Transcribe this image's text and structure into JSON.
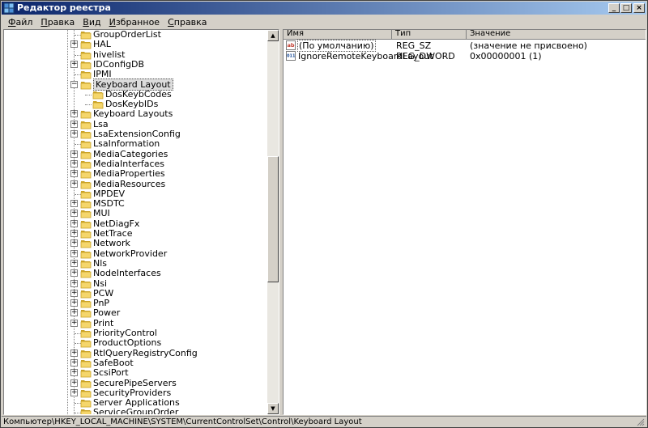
{
  "window": {
    "title": "Редактор реестра",
    "controls": {
      "minimize": "_",
      "maximize": "□",
      "close": "×"
    }
  },
  "menu": [
    {
      "hotkey": "Ф",
      "rest": "айл"
    },
    {
      "hotkey": "П",
      "rest": "равка"
    },
    {
      "hotkey": "В",
      "rest": "ид"
    },
    {
      "hotkey": "И",
      "rest": "збранное"
    },
    {
      "hotkey": "С",
      "rest": "правка"
    }
  ],
  "tree": {
    "items": [
      {
        "label": "GroupOrderList",
        "level": 0,
        "expander": ""
      },
      {
        "label": "HAL",
        "level": 0,
        "expander": "+"
      },
      {
        "label": "hivelist",
        "level": 0,
        "expander": ""
      },
      {
        "label": "IDConfigDB",
        "level": 0,
        "expander": "+"
      },
      {
        "label": "IPMI",
        "level": 0,
        "expander": ""
      },
      {
        "label": "Keyboard Layout",
        "level": 0,
        "expander": "-",
        "selected": true,
        "open": true
      },
      {
        "label": "DosKeybCodes",
        "level": 1,
        "expander": ""
      },
      {
        "label": "DosKeybIDs",
        "level": 1,
        "expander": ""
      },
      {
        "label": "Keyboard Layouts",
        "level": 0,
        "expander": "+"
      },
      {
        "label": "Lsa",
        "level": 0,
        "expander": "+"
      },
      {
        "label": "LsaExtensionConfig",
        "level": 0,
        "expander": "+"
      },
      {
        "label": "LsaInformation",
        "level": 0,
        "expander": ""
      },
      {
        "label": "MediaCategories",
        "level": 0,
        "expander": "+"
      },
      {
        "label": "MediaInterfaces",
        "level": 0,
        "expander": "+"
      },
      {
        "label": "MediaProperties",
        "level": 0,
        "expander": "+"
      },
      {
        "label": "MediaResources",
        "level": 0,
        "expander": "+"
      },
      {
        "label": "MPDEV",
        "level": 0,
        "expander": ""
      },
      {
        "label": "MSDTC",
        "level": 0,
        "expander": "+"
      },
      {
        "label": "MUI",
        "level": 0,
        "expander": "+"
      },
      {
        "label": "NetDiagFx",
        "level": 0,
        "expander": "+"
      },
      {
        "label": "NetTrace",
        "level": 0,
        "expander": "+"
      },
      {
        "label": "Network",
        "level": 0,
        "expander": "+"
      },
      {
        "label": "NetworkProvider",
        "level": 0,
        "expander": "+"
      },
      {
        "label": "Nls",
        "level": 0,
        "expander": "+"
      },
      {
        "label": "NodeInterfaces",
        "level": 0,
        "expander": "+"
      },
      {
        "label": "Nsi",
        "level": 0,
        "expander": "+"
      },
      {
        "label": "PCW",
        "level": 0,
        "expander": "+"
      },
      {
        "label": "PnP",
        "level": 0,
        "expander": "+"
      },
      {
        "label": "Power",
        "level": 0,
        "expander": "+"
      },
      {
        "label": "Print",
        "level": 0,
        "expander": "+"
      },
      {
        "label": "PriorityControl",
        "level": 0,
        "expander": ""
      },
      {
        "label": "ProductOptions",
        "level": 0,
        "expander": ""
      },
      {
        "label": "RtlQueryRegistryConfig",
        "level": 0,
        "expander": "+"
      },
      {
        "label": "SafeBoot",
        "level": 0,
        "expander": "+"
      },
      {
        "label": "ScsiPort",
        "level": 0,
        "expander": "+"
      },
      {
        "label": "SecurePipeServers",
        "level": 0,
        "expander": "+"
      },
      {
        "label": "SecurityProviders",
        "level": 0,
        "expander": "+"
      },
      {
        "label": "Server Applications",
        "level": 0,
        "expander": ""
      },
      {
        "label": "ServiceGroupOrder",
        "level": 0,
        "expander": ""
      }
    ]
  },
  "list": {
    "columns": {
      "name": "Имя",
      "type": "Тип",
      "value": "Значение"
    },
    "rows": [
      {
        "icon": "string-value-icon",
        "icon_text": "ab",
        "name": "(По умолчанию)",
        "type": "REG_SZ",
        "value": "(значение не присвоено)"
      },
      {
        "icon": "binary-value-icon",
        "icon_text": "011",
        "name": "IgnoreRemoteKeyboardLayout",
        "type": "REG_DWORD",
        "value": "0x00000001 (1)"
      }
    ]
  },
  "status": {
    "path": "Компьютер\\HKEY_LOCAL_MACHINE\\SYSTEM\\CurrentControlSet\\Control\\Keyboard Layout"
  },
  "colors": {
    "folder": "#f5d66b",
    "folder_dark": "#c9a227",
    "title_start": "#0a246a",
    "title_end": "#a6caf0"
  }
}
